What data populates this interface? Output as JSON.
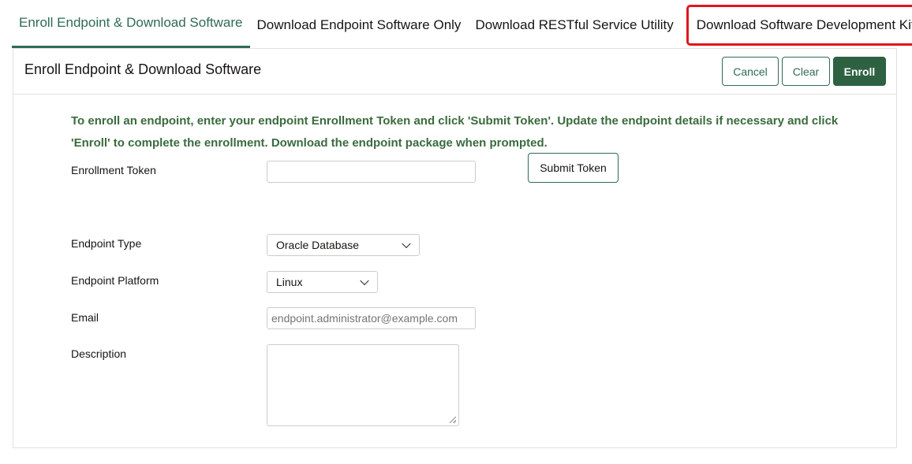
{
  "tabs": [
    {
      "label": "Enroll Endpoint & Download Software"
    },
    {
      "label": "Download Endpoint Software Only"
    },
    {
      "label": "Download RESTful Service Utility"
    },
    {
      "label": "Download Software Development Kit"
    }
  ],
  "panel": {
    "title": "Enroll Endpoint & Download Software",
    "cancel_label": "Cancel",
    "clear_label": "Clear",
    "enroll_label": "Enroll"
  },
  "instructions": "To enroll an endpoint, enter your endpoint Enrollment Token and click 'Submit Token'. Update the endpoint details if necessary and click 'Enroll' to complete the enrollment. Download the endpoint package when prompted.",
  "form": {
    "token_label": "Enrollment Token",
    "token_value": "",
    "submit_label": "Submit Token",
    "type_label": "Endpoint Type",
    "type_value": "Oracle Database",
    "platform_label": "Endpoint Platform",
    "platform_value": "Linux",
    "email_label": "Email",
    "email_placeholder": "endpoint.administrator@example.com",
    "description_label": "Description",
    "description_value": ""
  },
  "colors": {
    "accent": "#2f6b55",
    "enroll_button": "#2d6142",
    "instructions_text": "#3a6b3d",
    "highlight_box": "#e0161d"
  }
}
